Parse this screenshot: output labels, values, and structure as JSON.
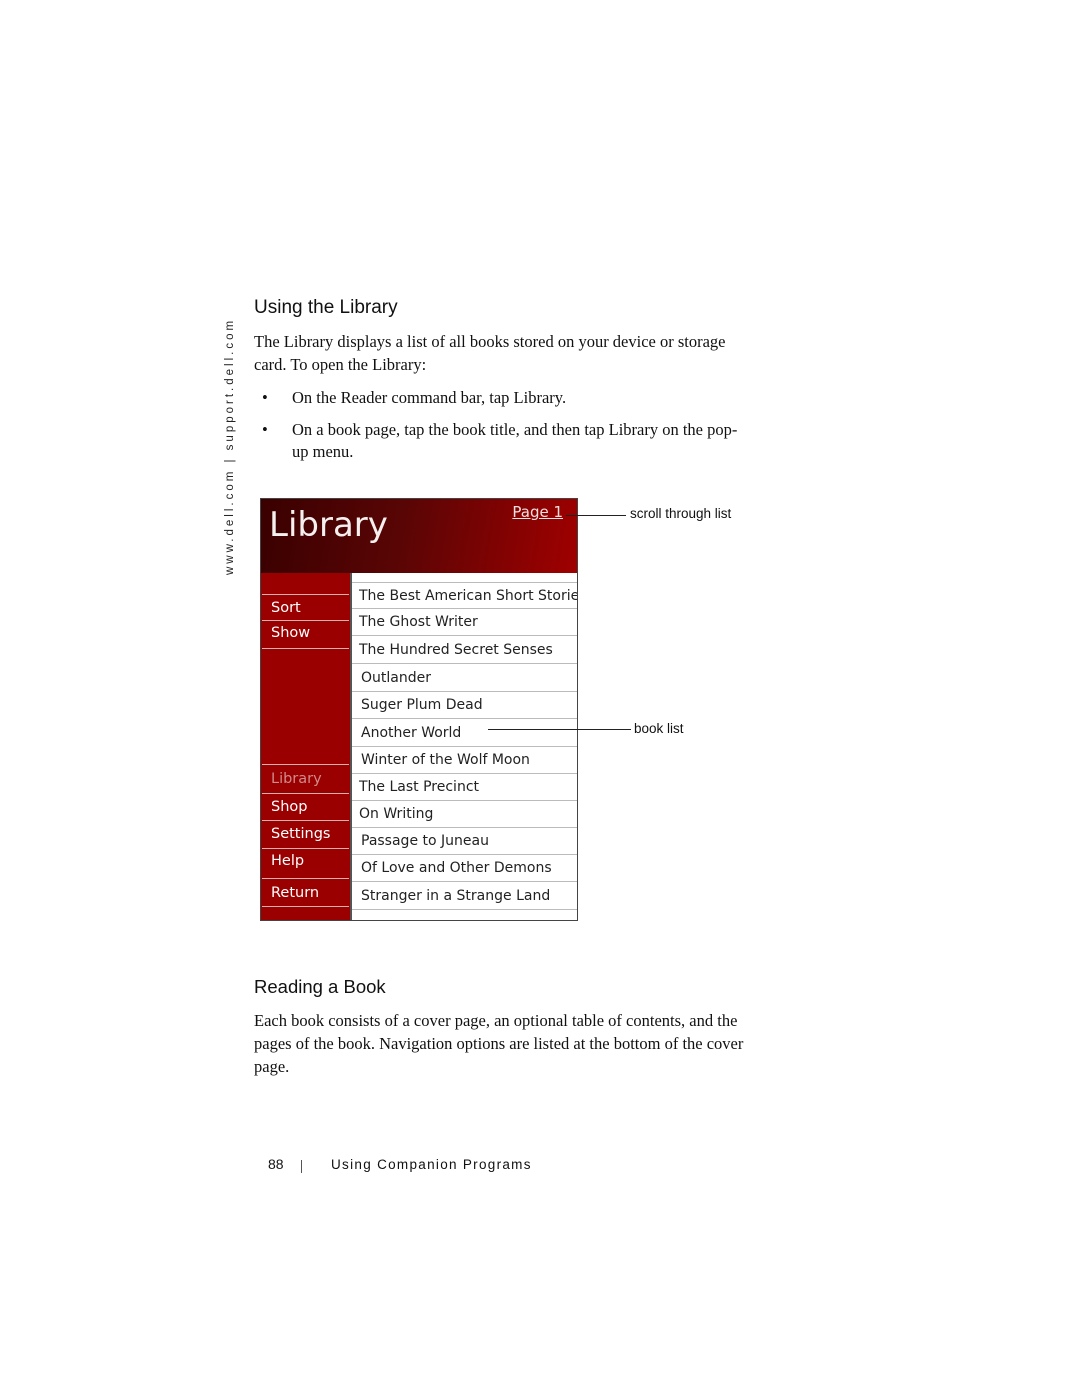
{
  "sidebar_url": "www.dell.com  |  support.dell.com",
  "section1": {
    "heading": "Using the Library",
    "intro_line1": "The Library displays a list of all books stored on your device or storage",
    "intro_line2": "card. To open the Library:",
    "bullets": [
      {
        "symbol": "•",
        "line1": "On the Reader command bar, tap Library.",
        "line2": ""
      },
      {
        "symbol": "•",
        "line1": "On a book page, tap the book title, and then tap Library on the pop-",
        "line2": "up menu."
      }
    ]
  },
  "screenshot": {
    "title": "Library",
    "page_link": "Page 1",
    "colors": {
      "banner_dark": "#3a0000",
      "banner_light": "#a00000",
      "menu_bg": "#9a0000"
    },
    "menu_top": [
      "Sort",
      "Show"
    ],
    "menu_bottom": [
      {
        "label": "Library",
        "active": true
      },
      {
        "label": "Shop",
        "active": false
      },
      {
        "label": "Settings",
        "active": false
      },
      {
        "label": "Help",
        "active": false
      },
      {
        "label": "Return",
        "active": false
      }
    ],
    "books": [
      "The Best American Short Stories",
      "The Ghost Writer",
      "The Hundred Secret Senses",
      "Outlander",
      "Suger Plum Dead",
      "Another World",
      "Winter of the Wolf Moon",
      "The Last Precinct",
      "On Writing",
      "Passage to Juneau",
      "Of Love and Other Demons",
      "Stranger in a Strange Land"
    ]
  },
  "callouts": {
    "scroll": "scroll through list",
    "booklist": "book list"
  },
  "section2": {
    "heading": "Reading a Book",
    "line1": "Each book consists of a cover page, an optional table of contents, and the",
    "line2": "pages of the book. Navigation options are listed at the bottom of the cover",
    "line3": "page."
  },
  "footer": {
    "page_number": "88",
    "chapter": "Using Companion Programs"
  }
}
